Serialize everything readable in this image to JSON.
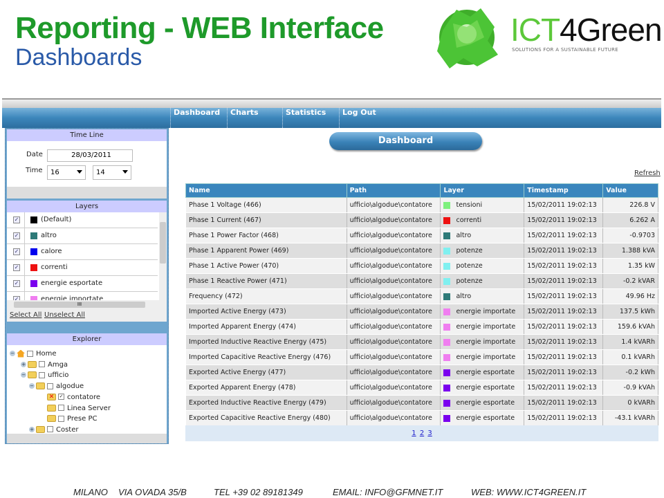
{
  "header": {
    "title": "Reporting - WEB Interface",
    "subtitle": "Dashboards"
  },
  "logo": {
    "text_a": "ICT",
    "text_b": "4Green",
    "tagline": "SOLUTIONS FOR A SUSTAINABLE FUTURE",
    "color": "#5cc83a"
  },
  "nav": {
    "items": [
      "Dashboard",
      "Charts",
      "Statistics",
      "Log Out"
    ]
  },
  "sidebar": {
    "timeline": {
      "title": "Time Line",
      "date_label": "Date",
      "date_value": "28/03/2011",
      "time_label": "Time",
      "hour": "16",
      "minute": "14"
    },
    "layers": {
      "title": "Layers",
      "items": [
        {
          "label": "(Default)",
          "color": "#000000",
          "checked": true
        },
        {
          "label": "altro",
          "color": "#2e7a78",
          "checked": true
        },
        {
          "label": "calore",
          "color": "#0000ee",
          "checked": true
        },
        {
          "label": "correnti",
          "color": "#ee1111",
          "checked": true
        },
        {
          "label": "energie esportate",
          "color": "#7a00ee",
          "checked": true
        },
        {
          "label": "energie importate",
          "color": "#f07ef0",
          "checked": true
        }
      ],
      "select_all": "Select All",
      "unselect_all": "Unselect All"
    },
    "explorer": {
      "title": "Explorer",
      "nodes": [
        {
          "label": "Home",
          "checked": false
        },
        {
          "label": "Amga",
          "checked": false
        },
        {
          "label": "ufficio",
          "checked": false
        },
        {
          "label": "algodue",
          "checked": false
        },
        {
          "label": "contatore",
          "checked": true
        },
        {
          "label": "Linea Server",
          "checked": false
        },
        {
          "label": "Prese PC",
          "checked": false
        },
        {
          "label": "Coster",
          "checked": false
        }
      ]
    }
  },
  "main": {
    "heading": "Dashboard",
    "refresh": "Refresh",
    "columns": [
      "Name",
      "Path",
      "Layer",
      "Timestamp",
      "Value"
    ],
    "rows": [
      {
        "name": "Phase 1 Voltage (466)",
        "path": "ufficio\\algodue\\contatore",
        "layer": "tensioni",
        "color": "#7ef07e",
        "ts": "15/02/2011 19:02:13",
        "value": "226.8 V"
      },
      {
        "name": "Phase 1 Current (467)",
        "path": "ufficio\\algodue\\contatore",
        "layer": "correnti",
        "color": "#ee1111",
        "ts": "15/02/2011 19:02:13",
        "value": "6.262 A"
      },
      {
        "name": "Phase 1 Power Factor (468)",
        "path": "ufficio\\algodue\\contatore",
        "layer": "altro",
        "color": "#2e7a78",
        "ts": "15/02/2011 19:02:13",
        "value": "-0.9703"
      },
      {
        "name": "Phase 1 Apparent Power (469)",
        "path": "ufficio\\algodue\\contatore",
        "layer": "potenze",
        "color": "#80f0f0",
        "ts": "15/02/2011 19:02:13",
        "value": "1.388 kVA"
      },
      {
        "name": "Phase 1 Active Power (470)",
        "path": "ufficio\\algodue\\contatore",
        "layer": "potenze",
        "color": "#80f0f0",
        "ts": "15/02/2011 19:02:13",
        "value": "1.35 kW"
      },
      {
        "name": "Phase 1 Reactive Power (471)",
        "path": "ufficio\\algodue\\contatore",
        "layer": "potenze",
        "color": "#80f0f0",
        "ts": "15/02/2011 19:02:13",
        "value": "-0.2 kVAR"
      },
      {
        "name": "Frequency (472)",
        "path": "ufficio\\algodue\\contatore",
        "layer": "altro",
        "color": "#2e7a78",
        "ts": "15/02/2011 19:02:13",
        "value": "49.96 Hz"
      },
      {
        "name": "Imported Active Energy (473)",
        "path": "ufficio\\algodue\\contatore",
        "layer": "energie importate",
        "color": "#f07ef0",
        "ts": "15/02/2011 19:02:13",
        "value": "137.5 kWh"
      },
      {
        "name": "Imported Apparent Energy (474)",
        "path": "ufficio\\algodue\\contatore",
        "layer": "energie importate",
        "color": "#f07ef0",
        "ts": "15/02/2011 19:02:13",
        "value": "159.6 kVAh"
      },
      {
        "name": "Imported Inductive Reactive Energy (475)",
        "path": "ufficio\\algodue\\contatore",
        "layer": "energie importate",
        "color": "#f07ef0",
        "ts": "15/02/2011 19:02:13",
        "value": "1.4 kVARh"
      },
      {
        "name": "Imported Capacitive Reactive Energy (476)",
        "path": "ufficio\\algodue\\contatore",
        "layer": "energie importate",
        "color": "#f07ef0",
        "ts": "15/02/2011 19:02:13",
        "value": "0.1 kVARh"
      },
      {
        "name": "Exported Active Energy (477)",
        "path": "ufficio\\algodue\\contatore",
        "layer": "energie esportate",
        "color": "#7a00ee",
        "ts": "15/02/2011 19:02:13",
        "value": "-0.2 kWh"
      },
      {
        "name": "Exported Apparent Energy (478)",
        "path": "ufficio\\algodue\\contatore",
        "layer": "energie esportate",
        "color": "#7a00ee",
        "ts": "15/02/2011 19:02:13",
        "value": "-0.9 kVAh"
      },
      {
        "name": "Exported Inductive Reactive Energy (479)",
        "path": "ufficio\\algodue\\contatore",
        "layer": "energie esportate",
        "color": "#7a00ee",
        "ts": "15/02/2011 19:02:13",
        "value": "0 kVARh"
      },
      {
        "name": "Exported Capacitive Reactive Energy (480)",
        "path": "ufficio\\algodue\\contatore",
        "layer": "energie esportate",
        "color": "#7a00ee",
        "ts": "15/02/2011 19:02:13",
        "value": "-43.1 kVARh"
      }
    ],
    "pages": [
      "1",
      "2",
      "3"
    ]
  },
  "footer": {
    "city": "MILANO",
    "address": "VIA OVADA 35/B",
    "tel": "TEL +39 02 89181349",
    "email": "EMAIL: INFO@GFMNET.IT",
    "web": "WEB: WWW.ICT4GREEN.IT"
  }
}
